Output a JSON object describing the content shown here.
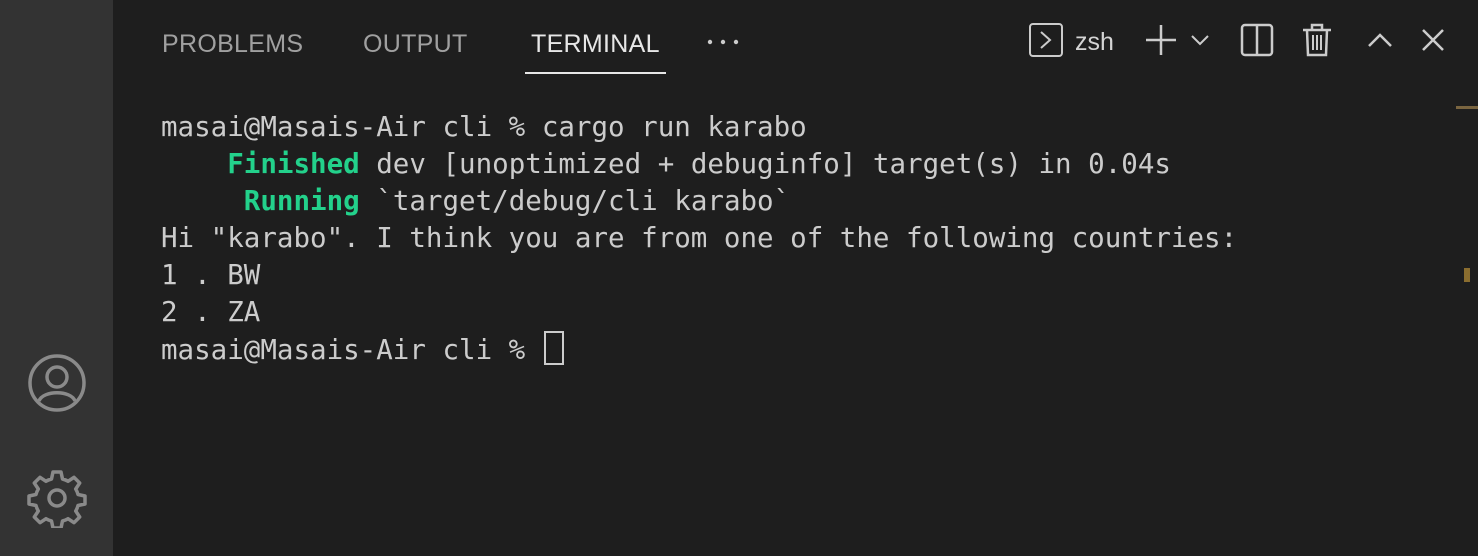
{
  "panel": {
    "tabs": [
      {
        "label": "PROBLEMS",
        "active": false
      },
      {
        "label": "OUTPUT",
        "active": false
      },
      {
        "label": "TERMINAL",
        "active": true
      }
    ],
    "more_icon": "ellipsis-icon",
    "shell": {
      "icon": "terminal-icon",
      "label": "zsh"
    },
    "actions": [
      {
        "name": "new-terminal",
        "icon": "plus-icon"
      },
      {
        "name": "launch-profile",
        "icon": "chevron-down-icon"
      },
      {
        "name": "split-terminal",
        "icon": "split-icon"
      },
      {
        "name": "kill-terminal",
        "icon": "trash-icon"
      },
      {
        "name": "maximize-panel",
        "icon": "chevron-up-icon"
      },
      {
        "name": "close-panel",
        "icon": "close-icon"
      }
    ]
  },
  "activity_bar": {
    "items": [
      {
        "name": "accounts",
        "icon": "account-icon"
      },
      {
        "name": "manage",
        "icon": "gear-icon"
      }
    ]
  },
  "terminal": {
    "lines": [
      {
        "prompt": "masai@Masais-Air cli % ",
        "command": "cargo run karabo"
      },
      {
        "indent": "    ",
        "status": "Finished",
        "rest": " dev [unoptimized + debuginfo] target(s) in 0.04s"
      },
      {
        "indent": "     ",
        "status": "Running",
        "rest": " `target/debug/cli karabo`"
      },
      {
        "text": "Hi \"karabo\". I think you are from one of the following countries:"
      },
      {
        "text": "1 . BW"
      },
      {
        "text": "2 . ZA"
      },
      {
        "prompt": "masai@Masais-Air cli % ",
        "command": ""
      }
    ]
  },
  "colors": {
    "background": "#1e1e1e",
    "activity_bar": "#333333",
    "text": "#cccccc",
    "success_green": "#23d18b",
    "tab_inactive": "#a0a0a0",
    "tab_active": "#e7e7e7"
  }
}
